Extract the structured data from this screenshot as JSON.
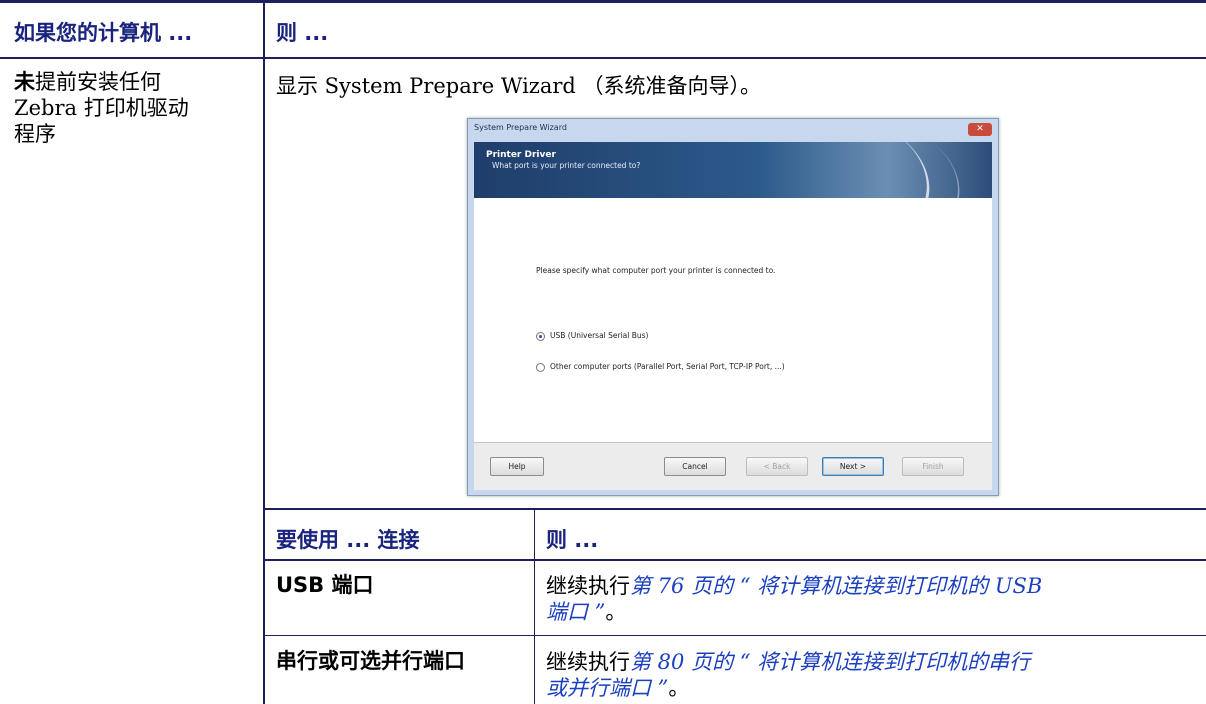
{
  "header": {
    "col1": "如果您的计算机 ...",
    "col2": "则 ..."
  },
  "row1": {
    "condition_bold": "未",
    "condition_rest_line1": "提前安装任何",
    "condition_line2": "Zebra 打印机驱动",
    "condition_line3": "程序",
    "action": "显示 System Prepare Wizard （系统准备向导）。"
  },
  "wizard": {
    "title": "System Prepare Wizard",
    "banner_title": "Printer Driver",
    "banner_subtitle": "What port is your printer connected to?",
    "prompt": "Please specify what computer port your printer is connected to.",
    "option_usb": "USB (Universal Serial Bus)",
    "option_other": "Other computer ports (Parallel Port, Serial Port, TCP-IP Port, ...)",
    "btn_help": "Help",
    "btn_cancel": "Cancel",
    "btn_back": "< Back",
    "btn_next": "Next >",
    "btn_finish": "Finish"
  },
  "subtable": {
    "header_col1": "要使用 ... 连接",
    "header_col2": "则 ...",
    "rows": [
      {
        "port_bold": "USB",
        "port_rest": " 端口",
        "prefix": "继续执行",
        "link_line1": "第  76 页的 “ 将计算机连接到打印机的 USB",
        "link_line2": "端口 ”",
        "suffix": "。"
      },
      {
        "port": "串行或可选并行端口",
        "prefix": "继续执行",
        "link_line1": "第  80 页的 “ 将计算机连接到打印机的串行",
        "link_line2": "或并行端口 ”",
        "suffix": "。"
      }
    ]
  },
  "colors": {
    "header_text": "#1a237e",
    "link": "#1a3fbf",
    "rule": "#1f1f5c"
  }
}
